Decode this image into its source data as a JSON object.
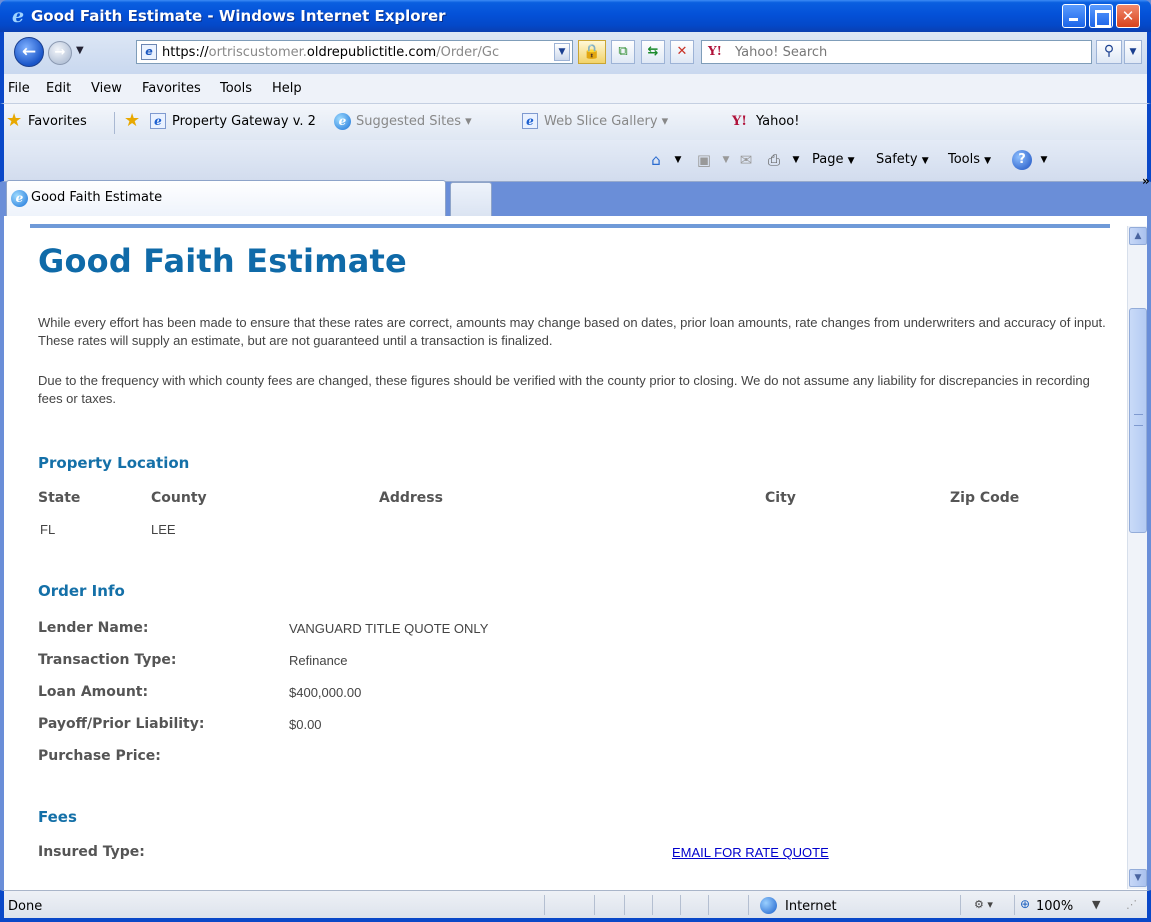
{
  "window": {
    "title": "Good Faith Estimate - Windows Internet Explorer"
  },
  "navbar": {
    "url_host_prefix": "https://",
    "url_host_dim": "ortriscustomer.",
    "url_host_main": "oldrepublictitle.com",
    "url_path": "/Order/Gc",
    "search_placeholder": "Yahoo! Search",
    "search_brand": "Y!"
  },
  "menu": {
    "items": [
      "File",
      "Edit",
      "View",
      "Favorites",
      "Tools",
      "Help"
    ]
  },
  "favorites_bar": {
    "favorites_label": "Favorites",
    "items": [
      {
        "label": "Property Gateway v. 2"
      },
      {
        "label": "Suggested Sites ▾"
      },
      {
        "label": "Web Slice Gallery ▾"
      },
      {
        "label": "Yahoo!"
      }
    ],
    "yahoo_brand": "Y!"
  },
  "tabs": {
    "active_label": "Good Faith Estimate"
  },
  "command_bar": {
    "page_label": "Page",
    "safety_label": "Safety",
    "tools_label": "Tools",
    "overflow_label": "»"
  },
  "page": {
    "title": "Good Faith Estimate",
    "disclaimer_1": "While every effort has been made to ensure that these rates are correct, amounts may change based on dates, prior loan amounts, rate changes from underwriters and accuracy of input. These rates will supply an estimate, but are not guaranteed until a transaction is finalized.",
    "disclaimer_2": "Due to the frequency with which county fees are changed, these figures should be verified with the county prior to closing. We do not assume any liability for discrepancies in recording fees or taxes.",
    "property_location": {
      "heading": "Property Location",
      "columns": [
        "State",
        "County",
        "Address",
        "City",
        "Zip Code"
      ],
      "row": [
        "FL",
        "LEE",
        "",
        "",
        ""
      ]
    },
    "order_info": {
      "heading": "Order Info",
      "fields": [
        {
          "label": "Lender Name:",
          "value": "VANGUARD TITLE QUOTE ONLY"
        },
        {
          "label": "Transaction Type:",
          "value": "Refinance"
        },
        {
          "label": "Loan Amount:",
          "value": "$400,000.00"
        },
        {
          "label": "Payoff/Prior Liability:",
          "value": "$0.00"
        },
        {
          "label": "Purchase Price:",
          "value": ""
        }
      ]
    },
    "fees": {
      "heading": "Fees",
      "insured_type_label": "Insured Type:",
      "email_link": "EMAIL FOR RATE QUOTE"
    }
  },
  "status": {
    "text": "Done",
    "zone": "Internet",
    "zoom": "100%"
  },
  "colors": {
    "heading_blue": "#0f6aa8",
    "xp_titlebar": "#0451d8",
    "link": "#0000cc"
  }
}
